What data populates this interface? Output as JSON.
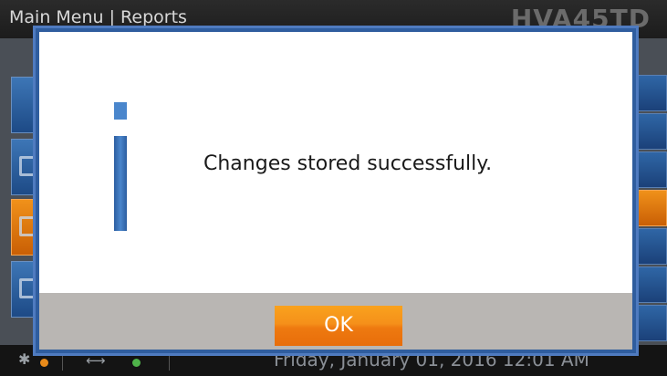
{
  "header": {
    "title": "Main Menu | Reports",
    "model": "HVA45TD"
  },
  "status_bar": {
    "bluetooth_icon": "bluetooth-icon",
    "usb_icon": "usb-icon",
    "datetime": "Friday, January 01, 2016 12:01 AM",
    "colors": {
      "bt_status": "#e88a1a",
      "usb_status": "#4fb34a"
    }
  },
  "dialog": {
    "icon": "info-icon",
    "message": "Changes stored successfully.",
    "ok_label": "OK",
    "accent": "#f5901a",
    "frame": "#2f5d9e"
  }
}
